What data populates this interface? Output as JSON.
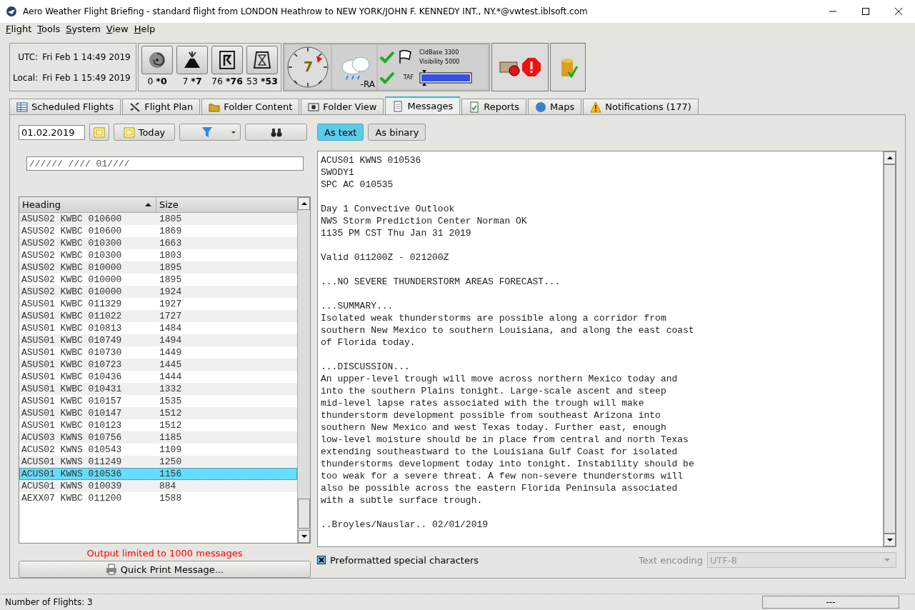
{
  "window": {
    "title": "Aero Weather Flight Briefing - standard flight from LONDON Heathrow to NEW YORK/JOHN F. KENNEDY INT., NY.*@vwtest.iblsoft.com"
  },
  "menu": [
    "Flight",
    "Tools",
    "System",
    "View",
    "Help"
  ],
  "clock": {
    "utc_label": "UTC:",
    "utc": "Fri Feb 1 14:49 2019",
    "local_label": "Local:",
    "local": "Fri Feb 1 15:49 2019"
  },
  "hazards": [
    {
      "kind": "cyclone",
      "count": "0",
      "bold": "*0"
    },
    {
      "kind": "volcano",
      "count": "7",
      "bold": "*7"
    },
    {
      "kind": "turn",
      "count": "76",
      "bold": "*76"
    },
    {
      "kind": "hourglass",
      "count": "53",
      "bold": "*53"
    }
  ],
  "weather": {
    "clock_value": "7",
    "condition": "-RA",
    "cloud_base": "CldBase 3300",
    "visibility": "Visibility 5000",
    "taf": "TAF"
  },
  "tabs": [
    {
      "label": "Scheduled Flights",
      "kind": "table",
      "selected": false
    },
    {
      "label": "Flight Plan",
      "kind": "plane",
      "selected": false
    },
    {
      "label": "Folder Content",
      "kind": "folder",
      "selected": false
    },
    {
      "label": "Folder View",
      "kind": "view",
      "selected": false
    },
    {
      "label": "Messages",
      "kind": "doc",
      "selected": true
    },
    {
      "label": "Reports",
      "kind": "report",
      "selected": false
    },
    {
      "label": "Maps",
      "kind": "globe",
      "selected": false
    },
    {
      "label": "Notifications (177)",
      "kind": "warning",
      "selected": false
    }
  ],
  "date": {
    "value": "01.02.2019",
    "today": "Today"
  },
  "filter": {
    "value": "////// //// 01////"
  },
  "view_modes": [
    {
      "label": "As text",
      "selected": true
    },
    {
      "label": "As binary",
      "selected": false
    }
  ],
  "table": {
    "columns": [
      "Heading",
      "Size"
    ],
    "rows": [
      {
        "heading": "ASUS02 KWBC 010600",
        "size": "1805",
        "selected": false
      },
      {
        "heading": "ASUS02 KWBC 010600",
        "size": "1869",
        "selected": false
      },
      {
        "heading": "ASUS02 KWBC 010300",
        "size": "1663",
        "selected": false
      },
      {
        "heading": "ASUS02 KWBC 010300",
        "size": "1803",
        "selected": false
      },
      {
        "heading": "ASUS02 KWBC 010000",
        "size": "1895",
        "selected": false
      },
      {
        "heading": "ASUS02 KWBC 010000",
        "size": "1895",
        "selected": false
      },
      {
        "heading": "ASUS02 KWBC 010000",
        "size": "1924",
        "selected": false
      },
      {
        "heading": "ASUS01 KWBC 011329",
        "size": "1927",
        "selected": false
      },
      {
        "heading": "ASUS01 KWBC 011022",
        "size": "1727",
        "selected": false
      },
      {
        "heading": "ASUS01 KWBC 010813",
        "size": "1484",
        "selected": false
      },
      {
        "heading": "ASUS01 KWBC 010749",
        "size": "1494",
        "selected": false
      },
      {
        "heading": "ASUS01 KWBC 010730",
        "size": "1449",
        "selected": false
      },
      {
        "heading": "ASUS01 KWBC 010723",
        "size": "1445",
        "selected": false
      },
      {
        "heading": "ASUS01 KWBC 010436",
        "size": "1444",
        "selected": false
      },
      {
        "heading": "ASUS01 KWBC 010431",
        "size": "1332",
        "selected": false
      },
      {
        "heading": "ASUS01 KWBC 010157",
        "size": "1535",
        "selected": false
      },
      {
        "heading": "ASUS01 KWBC 010147",
        "size": "1512",
        "selected": false
      },
      {
        "heading": "ASUS01 KWBC 010123",
        "size": "1512",
        "selected": false
      },
      {
        "heading": "ACUS03 KWNS 010756",
        "size": "1185",
        "selected": false
      },
      {
        "heading": "ACUS02 KWNS 010543",
        "size": "1109",
        "selected": false
      },
      {
        "heading": "ACUS01 KWNS 011249",
        "size": "1250",
        "selected": false
      },
      {
        "heading": "ACUS01 KWNS 010536",
        "size": "1156",
        "selected": true
      },
      {
        "heading": "ACUS01 KWNS 010039",
        "size": "884",
        "selected": false
      },
      {
        "heading": "AEXX07 KWBC 011200",
        "size": "1588",
        "selected": false
      }
    ]
  },
  "limit_note": "Output limited to 1000 messages",
  "print_button": "Quick Print Message...",
  "message": [
    [
      "ACUS01 KWNS 010536",
      "SWODY1",
      "SPC AC 010535"
    ],
    [
      "Day 1 Convective Outlook",
      "NWS Storm Prediction Center Norman OK",
      "1135 PM CST Thu Jan 31 2019"
    ],
    [
      "Valid 011200Z - 021200Z"
    ],
    [
      "...NO SEVERE THUNDERSTORM AREAS FORECAST..."
    ],
    [
      "...SUMMARY...",
      "Isolated weak thunderstorms are possible along a corridor from",
      "southern New Mexico to southern Louisiana, and along the east coast",
      "of Florida today."
    ],
    [
      "...DISCUSSION...",
      "An upper-level trough will move across northern Mexico today and",
      "into the southern Plains tonight. Large-scale ascent and steep",
      "mid-level lapse rates associated with the trough will make",
      "thunderstorm development possible from southeast Arizona into",
      "southern New Mexico and west Texas today. Further east, enough",
      "low-level moisture should be in place from central and north Texas",
      "extending southeastward to the Louisiana Gulf Coast for isolated",
      "thunderstorms development today into tonight. Instability should be",
      "too weak for a severe threat. A few non-severe thunderstorms will",
      "also be possible across the eastern Florida Peninsula associated",
      "with a subtle surface trough."
    ],
    [
      "..Broyles/Nauslar.. 02/01/2019"
    ]
  ],
  "preformatted": {
    "label": "Preformatted special characters",
    "checked": true
  },
  "encoding": {
    "label": "Text encoding",
    "value": "UTF-8",
    "disabled": true
  },
  "status_bar": {
    "text": "Number of Flights: 3",
    "right": "---"
  }
}
